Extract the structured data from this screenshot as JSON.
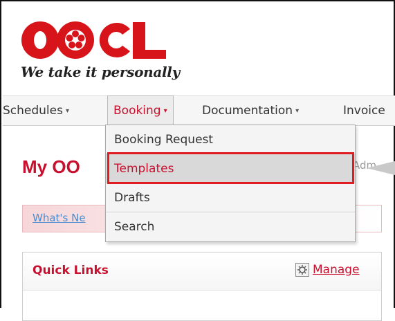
{
  "brand": {
    "logo_text": "OOCL",
    "tagline": "We take it personally",
    "brand_color": "#c8102e"
  },
  "nav": {
    "items": [
      {
        "label": "Schedules"
      },
      {
        "label": "Booking"
      },
      {
        "label": "Documentation"
      },
      {
        "label": "Invoice"
      }
    ],
    "active": "Booking"
  },
  "booking_menu": {
    "items": [
      {
        "label": "Booking Request"
      },
      {
        "label": "Templates"
      },
      {
        "label": "Drafts"
      },
      {
        "label": "Search"
      }
    ],
    "highlighted": "Templates",
    "highlight_color": "#e11b22"
  },
  "page": {
    "title_partial": "My OO",
    "admin_partial": "Adm",
    "whats_new_partial": "What's Ne"
  },
  "quick_links": {
    "title": "Quick Links",
    "manage_label": "Manage",
    "manage_icon": "settings-gear-icon"
  }
}
